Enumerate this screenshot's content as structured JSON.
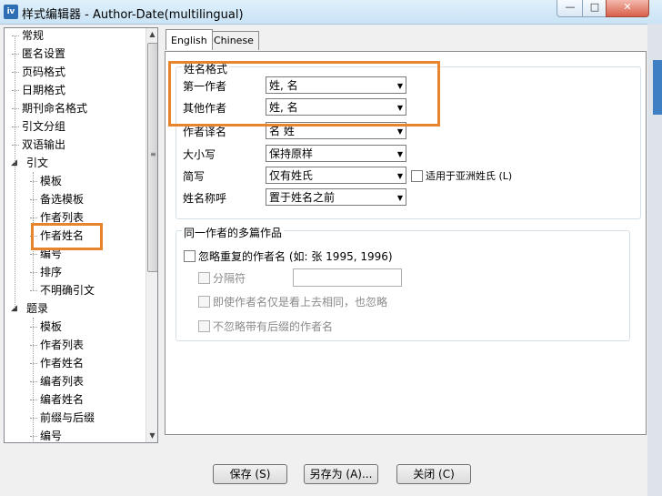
{
  "window": {
    "title": "样式编辑器 - Author-Date(multilingual)",
    "icon": "app-logo-icon",
    "icon_text": "ⅳ"
  },
  "controls": {
    "minimize": "—",
    "maximize": "□",
    "close": "✕"
  },
  "tree": {
    "items": [
      {
        "label": "常规",
        "level": 1
      },
      {
        "label": "匿名设置",
        "level": 1
      },
      {
        "label": "页码格式",
        "level": 1
      },
      {
        "label": "日期格式",
        "level": 1
      },
      {
        "label": "期刊命名格式",
        "level": 1
      },
      {
        "label": "引文分组",
        "level": 1
      },
      {
        "label": "双语输出",
        "level": 1
      },
      {
        "label": "引文",
        "level": 1,
        "expanded": true
      },
      {
        "label": "模板",
        "level": 2
      },
      {
        "label": "备选模板",
        "level": 2
      },
      {
        "label": "作者列表",
        "level": 2
      },
      {
        "label": "作者姓名",
        "level": 2,
        "selected": true
      },
      {
        "label": "编号",
        "level": 2
      },
      {
        "label": "排序",
        "level": 2
      },
      {
        "label": "不明确引文",
        "level": 2
      },
      {
        "label": "题录",
        "level": 1,
        "expanded": true
      },
      {
        "label": "模板",
        "level": 2
      },
      {
        "label": "作者列表",
        "level": 2
      },
      {
        "label": "作者姓名",
        "level": 2
      },
      {
        "label": "编者列表",
        "level": 2
      },
      {
        "label": "编者姓名",
        "level": 2
      },
      {
        "label": "前缀与后缀",
        "level": 2
      },
      {
        "label": "编号",
        "level": 2
      }
    ]
  },
  "tabs": [
    {
      "label": "English",
      "active": true
    },
    {
      "label": "Chinese",
      "active": false
    }
  ],
  "name_format": {
    "title": "姓名格式",
    "first_author_label": "第一作者",
    "first_author_value": "姓, 名",
    "other_authors_label": "其他作者",
    "other_authors_value": "姓, 名",
    "translated_name_label": "作者译名",
    "translated_name_value": "名 姓",
    "capitalization_label": "大小写",
    "capitalization_value": "保持原样",
    "abbreviation_label": "简写",
    "abbreviation_value": "仅有姓氏",
    "asian_surname_checkbox": "适用于亚洲姓氏 (L)",
    "honorific_label": "姓名称呼",
    "honorific_value": "置于姓名之前"
  },
  "same_author": {
    "title": "同一作者的多篇作品",
    "omit_repeated": "忽略重复的作者名 (如: 张 1995, 1996)",
    "separator_label": "分隔符",
    "separator_value": "",
    "omit_if_same": "即使作者名仅是看上去相同，也忽略",
    "dont_omit_suffix": "不忽略带有后缀的作者名"
  },
  "buttons": {
    "save": "保存 (S)",
    "save_as": "另存为 (A)...",
    "close": "关闭 (C)"
  },
  "colors": {
    "highlight": "#e8852c",
    "title_bar": "#c9e3f5"
  }
}
